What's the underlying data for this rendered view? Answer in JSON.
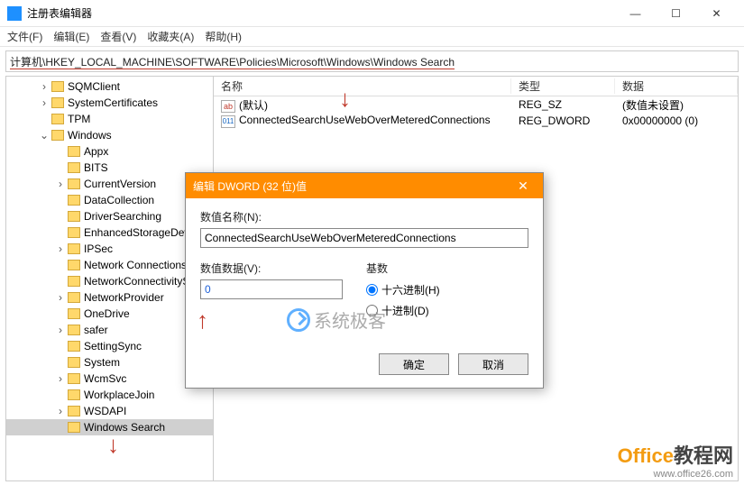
{
  "app": {
    "title": "注册表编辑器"
  },
  "win_controls": {
    "min": "—",
    "max": "☐",
    "close": "✕"
  },
  "menu": {
    "file": "文件(F)",
    "edit": "编辑(E)",
    "view": "查看(V)",
    "fav": "收藏夹(A)",
    "help": "帮助(H)"
  },
  "path": "计算机\\HKEY_LOCAL_MACHINE\\SOFTWARE\\Policies\\Microsoft\\Windows\\Windows Search",
  "tree": {
    "items": [
      {
        "label": "SQMClient",
        "depth": 1,
        "exp": "›"
      },
      {
        "label": "SystemCertificates",
        "depth": 1,
        "exp": "›"
      },
      {
        "label": "TPM",
        "depth": 1,
        "exp": ""
      },
      {
        "label": "Windows",
        "depth": 1,
        "exp": "⌄"
      },
      {
        "label": "Appx",
        "depth": 2,
        "exp": ""
      },
      {
        "label": "BITS",
        "depth": 2,
        "exp": ""
      },
      {
        "label": "CurrentVersion",
        "depth": 2,
        "exp": "›"
      },
      {
        "label": "DataCollection",
        "depth": 2,
        "exp": ""
      },
      {
        "label": "DriverSearching",
        "depth": 2,
        "exp": ""
      },
      {
        "label": "EnhancedStorageDevice",
        "depth": 2,
        "exp": ""
      },
      {
        "label": "IPSec",
        "depth": 2,
        "exp": "›"
      },
      {
        "label": "Network Connections",
        "depth": 2,
        "exp": ""
      },
      {
        "label": "NetworkConnectivitySta",
        "depth": 2,
        "exp": ""
      },
      {
        "label": "NetworkProvider",
        "depth": 2,
        "exp": "›"
      },
      {
        "label": "OneDrive",
        "depth": 2,
        "exp": ""
      },
      {
        "label": "safer",
        "depth": 2,
        "exp": "›"
      },
      {
        "label": "SettingSync",
        "depth": 2,
        "exp": ""
      },
      {
        "label": "System",
        "depth": 2,
        "exp": ""
      },
      {
        "label": "WcmSvc",
        "depth": 2,
        "exp": "›"
      },
      {
        "label": "WorkplaceJoin",
        "depth": 2,
        "exp": ""
      },
      {
        "label": "WSDAPI",
        "depth": 2,
        "exp": "›"
      },
      {
        "label": "Windows Search",
        "depth": 2,
        "exp": "",
        "sel": true
      }
    ]
  },
  "list": {
    "header": {
      "name": "名称",
      "type": "类型",
      "data": "数据"
    },
    "rows": [
      {
        "icon": "ab",
        "name": "(默认)",
        "type": "REG_SZ",
        "data": "(数值未设置)"
      },
      {
        "icon": "011",
        "name": "ConnectedSearchUseWebOverMeteredConnections",
        "type": "REG_DWORD",
        "data": "0x00000000 (0)"
      }
    ]
  },
  "dialog": {
    "title": "编辑 DWORD (32 位)值",
    "name_label": "数值名称(N):",
    "name_value": "ConnectedSearchUseWebOverMeteredConnections",
    "data_label": "数值数据(V):",
    "data_value": "0",
    "base_label": "基数",
    "radio_hex": "十六进制(H)",
    "radio_dec": "十进制(D)",
    "ok": "确定",
    "cancel": "取消"
  },
  "watermark": {
    "brand1": "Office",
    "brand2": "教程网",
    "url": "www.office26.com"
  },
  "centermark": "系统极客"
}
